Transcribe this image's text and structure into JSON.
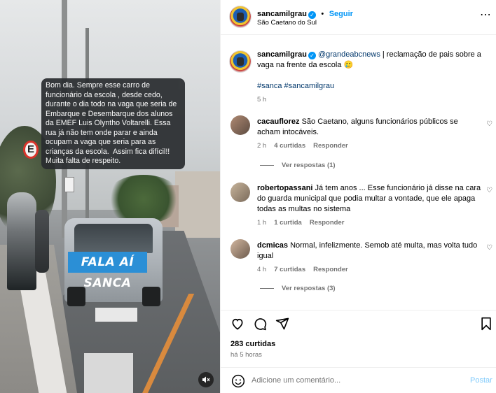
{
  "media": {
    "overlay_text": "Bom dia. Sempre esse carro de funcionário da escola , desde cedo, durante o dia todo na vaga que seria de Embarque e Desembarque dos alunos da EMEF Luis Olyntho Voltarelli. Essa rua já não tem onde parar e ainda ocupam a vaga que seria para as crianças da escola.  Assim fica difícil!! Muita falta de respeito.",
    "badge_text": "FALA AÍ SANCA",
    "sign_letter": "E",
    "mute_icon": "speaker-muted-icon"
  },
  "header": {
    "username": "sancamilgrau",
    "follow_label": "Seguir",
    "separator": "•",
    "location": "São Caetano do Sul",
    "more_icon": "ellipsis-icon"
  },
  "caption": {
    "username": "sancamilgrau",
    "mention": "@grandeabcnews",
    "text": " | reclamação de pais sobre a vaga na frente da escola 🥲",
    "hashtags": "#sanca #sancamilgrau",
    "time": "5 h"
  },
  "comments": [
    {
      "username": "cacauflorez",
      "text": "São Caetano, alguns funcionários públicos se acham intocáveis.",
      "time": "2 h",
      "likes": "4 curtidas",
      "reply_label": "Responder",
      "view_replies": "Ver respostas (1)"
    },
    {
      "username": "robertopassani",
      "text": "Já tem anos ... Esse funcionário já disse na cara do guarda municipal que podia multar a vontade, que ele apaga todas as multas no sistema",
      "time": "1 h",
      "likes": "1 curtida",
      "reply_label": "Responder"
    },
    {
      "username": "dcmicas",
      "text": "Normal, infelizmente. Semob até multa, mas volta tudo igual",
      "time": "4 h",
      "likes": "7 curtidas",
      "reply_label": "Responder",
      "view_replies": "Ver respostas (3)"
    }
  ],
  "actions": {
    "like_icon": "heart-icon",
    "comment_icon": "comment-bubble-icon",
    "share_icon": "paper-plane-icon",
    "save_icon": "bookmark-icon",
    "likes_count": "283 curtidas",
    "posted_time": "há 5 horas"
  },
  "comment_input": {
    "placeholder": "Adicione um comentário...",
    "post_label": "Postar",
    "emoji_icon": "smiley-icon"
  },
  "colors": {
    "accent": "#0095f6",
    "badge": "#2b8fd6",
    "muted": "#737373"
  }
}
